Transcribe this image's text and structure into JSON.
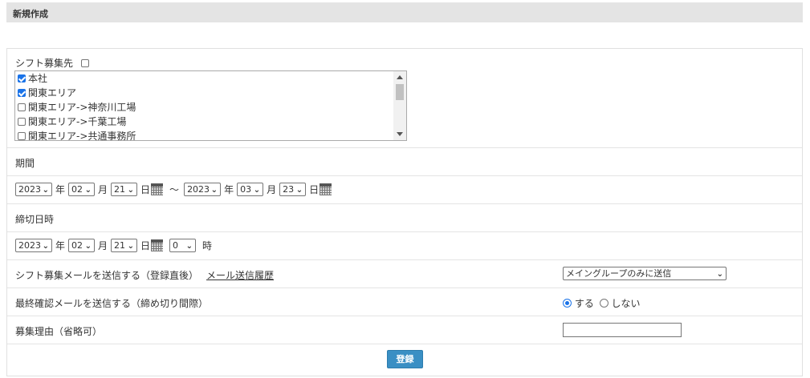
{
  "header": {
    "title": "新規作成"
  },
  "shift_target": {
    "label": "シフト募集先",
    "select_all_checked": false,
    "items": [
      {
        "label": "本社",
        "checked": true
      },
      {
        "label": "関東エリア",
        "checked": true
      },
      {
        "label": "関東エリア->神奈川工場",
        "checked": false
      },
      {
        "label": "関東エリア->千葉工場",
        "checked": false
      },
      {
        "label": "関東エリア->共通事務所",
        "checked": false
      }
    ]
  },
  "period": {
    "label": "期間",
    "start": {
      "year": "2023",
      "month": "02",
      "day": "21"
    },
    "end": {
      "year": "2023",
      "month": "03",
      "day": "23"
    },
    "year_unit": "年",
    "month_unit": "月",
    "day_unit": "日",
    "separator": "～"
  },
  "deadline": {
    "label": "締切日時",
    "year": "2023",
    "month": "02",
    "day": "21",
    "hour": "0",
    "year_unit": "年",
    "month_unit": "月",
    "day_unit": "日",
    "hour_unit": "時"
  },
  "recruit_mail": {
    "label": "シフト募集メールを送信する（登録直後）",
    "history_link": "メール送信履歴",
    "select_value": "メイングループのみに送信"
  },
  "confirm_mail": {
    "label": "最終確認メールを送信する（締め切り間際）",
    "option_yes": "する",
    "option_no": "しない",
    "selected": "yes"
  },
  "reason": {
    "label": "募集理由（省略可）",
    "value": ""
  },
  "submit": {
    "label": "登録"
  },
  "colors": {
    "accent": "#3a8fc4",
    "check": "#1a73e8",
    "header_bg": "#e4e4e4"
  }
}
